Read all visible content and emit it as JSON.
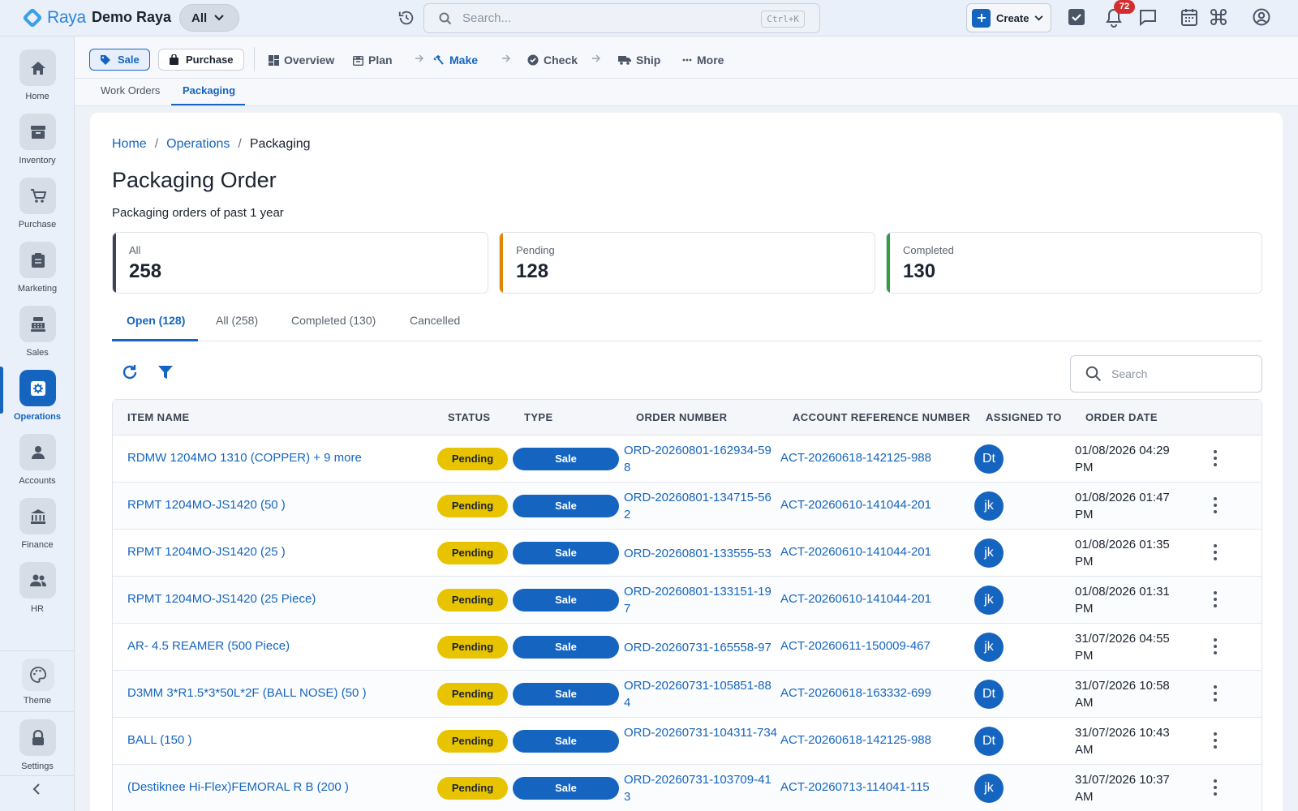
{
  "app": {
    "brand": "Raya",
    "company": "Demo Raya",
    "scope": "All",
    "search_placeholder": "Search...",
    "search_shortcut": "Ctrl+K",
    "create_label": "Create",
    "notification_count": "72"
  },
  "sidebar": {
    "items": [
      {
        "label": "Home",
        "icon": "home-icon"
      },
      {
        "label": "Inventory",
        "icon": "inventory-icon"
      },
      {
        "label": "Purchase",
        "icon": "cart-icon"
      },
      {
        "label": "Marketing",
        "icon": "clipboard-icon"
      },
      {
        "label": "Sales",
        "icon": "register-icon"
      },
      {
        "label": "Operations",
        "icon": "operations-icon",
        "active": true
      },
      {
        "label": "Accounts",
        "icon": "person-icon"
      },
      {
        "label": "Finance",
        "icon": "bank-icon"
      },
      {
        "label": "HR",
        "icon": "people-icon"
      }
    ],
    "theme_label": "Theme",
    "settings_label": "Settings"
  },
  "modules": {
    "sale": "Sale",
    "purchase": "Purchase",
    "flow": [
      "Overview",
      "Plan",
      "Make",
      "Check",
      "Ship",
      "More"
    ],
    "active_flow": "Make"
  },
  "subtabs": [
    "Work Orders",
    "Packaging"
  ],
  "breadcrumb": {
    "home": "Home",
    "section": "Operations",
    "current": "Packaging"
  },
  "page": {
    "title": "Packaging Order",
    "subtitle": "Packaging orders of past 1 year"
  },
  "stats": [
    {
      "label": "All",
      "value": "258",
      "color": "#3a4452"
    },
    {
      "label": "Pending",
      "value": "128",
      "color": "#e08600"
    },
    {
      "label": "Completed",
      "value": "130",
      "color": "#2e9e44"
    }
  ],
  "order_tabs": [
    "Open (128)",
    "All (258)",
    "Completed (130)",
    "Cancelled"
  ],
  "table_search_placeholder": "Search",
  "columns": [
    "ITEM NAME",
    "STATUS",
    "TYPE",
    "ORDER NUMBER",
    "ACCOUNT REFERENCE NUMBER",
    "ASSIGNED TO",
    "ORDER DATE"
  ],
  "rows": [
    {
      "item": "RDMW 1204MO 1310 (COPPER) + 9 more",
      "status": "Pending",
      "type": "Sale",
      "order": "ORD-20260801-162934-598",
      "account": "ACT-20260618-142125-988",
      "assigned": "Dt",
      "date": "01/08/2026 04:29 PM"
    },
    {
      "item": "RPMT 1204MO-JS1420 (50 )",
      "status": "Pending",
      "type": "Sale",
      "order": "ORD-20260801-134715-562",
      "account": "ACT-20260610-141044-201",
      "assigned": "jk",
      "date": "01/08/2026 01:47 PM"
    },
    {
      "item": "RPMT 1204MO-JS1420 (25 )",
      "status": "Pending",
      "type": "Sale",
      "order": "ORD-20260801-133555-53",
      "account": "ACT-20260610-141044-201",
      "assigned": "jk",
      "date": "01/08/2026 01:35 PM"
    },
    {
      "item": "RPMT 1204MO-JS1420 (25 Piece)",
      "status": "Pending",
      "type": "Sale",
      "order": "ORD-20260801-133151-197",
      "account": "ACT-20260610-141044-201",
      "assigned": "jk",
      "date": "01/08/2026 01:31 PM"
    },
    {
      "item": "AR- 4.5 REAMER (500 Piece)",
      "status": "Pending",
      "type": "Sale",
      "order": "ORD-20260731-165558-97",
      "account": "ACT-20260611-150009-467",
      "assigned": "jk",
      "date": "31/07/2026 04:55 PM"
    },
    {
      "item": "D3MM 3*R1.5*3*50L*2F (BALL NOSE) (50 )",
      "status": "Pending",
      "type": "Sale",
      "order": "ORD-20260731-105851-884",
      "account": "ACT-20260618-163332-699",
      "assigned": "Dt",
      "date": "31/07/2026 10:58 AM"
    },
    {
      "item": "BALL (150 )",
      "status": "Pending",
      "type": "Sale",
      "order": "ORD-20260731-104311-734",
      "account": "ACT-20260618-142125-988",
      "assigned": "Dt",
      "date": "31/07/2026 10:43 AM"
    },
    {
      "item": "(Destiknee Hi-Flex)FEMORAL R B (200 )",
      "status": "Pending",
      "type": "Sale",
      "order": "ORD-20260731-103709-413",
      "account": "ACT-20260713-114041-115",
      "assigned": "jk",
      "date": "31/07/2026 10:37 AM"
    }
  ]
}
